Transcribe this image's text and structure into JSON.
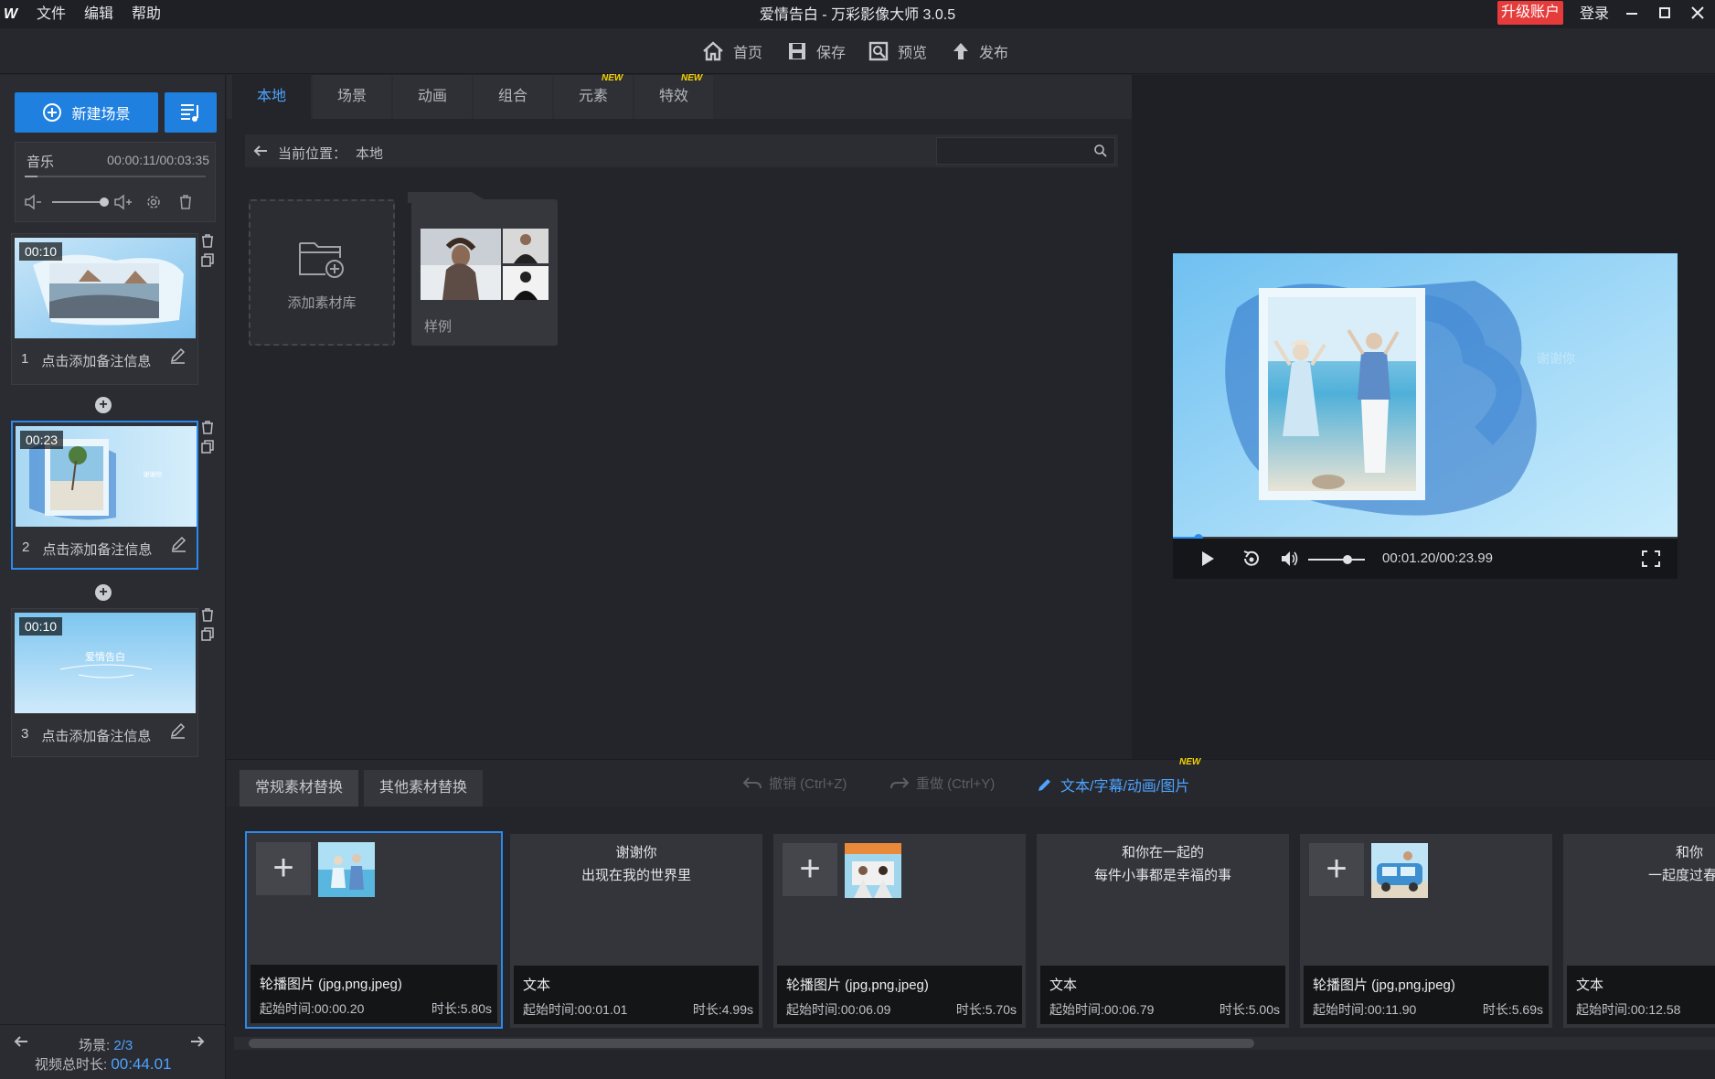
{
  "menu": {
    "logo": "W",
    "file": "文件",
    "edit": "编辑",
    "help": "帮助"
  },
  "window": {
    "title": "爱情告白 - 万彩影像大师 3.0.5",
    "upgrade": "升级账户",
    "login": "登录"
  },
  "toolbar": {
    "home": "首页",
    "save": "保存",
    "preview": "预览",
    "publish": "发布"
  },
  "left": {
    "new_scene": "新建场景",
    "music_label": "音乐",
    "music_time": "00:00:11/00:03:35",
    "scenes": [
      {
        "time": "00:10",
        "index": "1",
        "note": "点击添加备注信息"
      },
      {
        "time": "00:23",
        "index": "2",
        "note": "点击添加备注信息"
      },
      {
        "time": "00:10",
        "index": "3",
        "note": "点击添加备注信息",
        "thumb_text": "爱情告白"
      }
    ],
    "scene_nav_label": "场景: ",
    "scene_nav_value": "2/3",
    "total_label": "视频总时长: ",
    "total_value": "00:44.01"
  },
  "center": {
    "tabs": [
      "本地",
      "场景",
      "动画",
      "组合",
      "元素",
      "特效"
    ],
    "new_tag": "NEW",
    "path_label": "当前位置：",
    "path_value": "本地",
    "search_placeholder": "",
    "add_library": "添加素材库",
    "sample": "样例"
  },
  "preview": {
    "overlay_text": "谢谢你",
    "time": "00:01.20/00:23.99",
    "progress": 0.05,
    "volume": 0.7
  },
  "bottom": {
    "tab_regular": "常规素材替换",
    "tab_other": "其他素材替换",
    "undo": "撤销 (Ctrl+Z)",
    "redo": "重做 (Ctrl+Y)",
    "text_link": "文本/字幕/动画/图片",
    "new_tag": "NEW",
    "cards": [
      {
        "type": "image",
        "title": "轮播图片 (jpg,png,jpeg)",
        "start": "起始时间:00:00.20",
        "dur": "时长:5.80s"
      },
      {
        "type": "text",
        "text1": "谢谢你",
        "text2": "出现在我的世界里",
        "title": "文本",
        "start": "起始时间:00:01.01",
        "dur": "时长:4.99s"
      },
      {
        "type": "image",
        "title": "轮播图片 (jpg,png,jpeg)",
        "start": "起始时间:00:06.09",
        "dur": "时长:5.70s"
      },
      {
        "type": "text",
        "text1": "和你在一起的",
        "text2": "每件小事都是幸福的事",
        "title": "文本",
        "start": "起始时间:00:06.79",
        "dur": "时长:5.00s"
      },
      {
        "type": "image",
        "title": "轮播图片 (jpg,png,jpeg)",
        "start": "起始时间:00:11.90",
        "dur": "时长:5.69s"
      },
      {
        "type": "text",
        "text1": "和你",
        "text2": "一起度过春夏",
        "title": "文本",
        "start": "起始时间:00:12.58",
        "dur": ""
      }
    ]
  },
  "colors": {
    "accent": "#1f80e0",
    "upgrade": "#e63b3b",
    "link": "#4ea3ff"
  }
}
